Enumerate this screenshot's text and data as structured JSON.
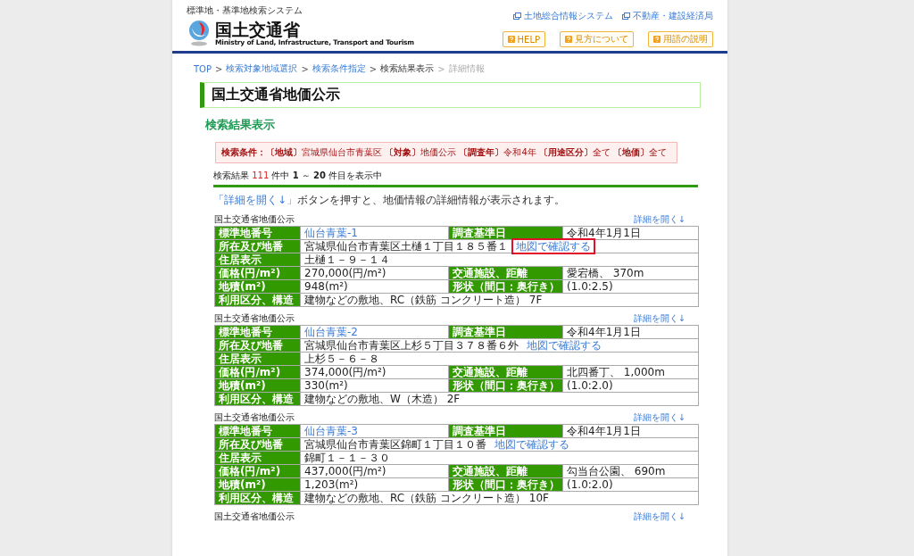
{
  "header": {
    "system_name": "標準地・基準地検索システム",
    "logo_name": "国土交通省",
    "logo_english": "Ministry of Land, Infrastructure, Transport and Tourism",
    "links": [
      "土地総合情報システム",
      "不動産・建設経済局"
    ],
    "help_buttons": [
      "HELP",
      "見方について",
      "用語の説明"
    ]
  },
  "breadcrumb": [
    {
      "label": "TOP",
      "kind": "link",
      "separator": ">"
    },
    {
      "label": "検索対象地域選択",
      "kind": "link",
      "separator": ">"
    },
    {
      "label": "検索条件指定",
      "kind": "link",
      "separator": ">"
    },
    {
      "label": "検索結果表示",
      "kind": "current",
      "separator": ">"
    },
    {
      "label": "詳細情報",
      "kind": "pending"
    }
  ],
  "page_title": "国土交通省地価公示",
  "section_title": "検索結果表示",
  "conditions": {
    "label": "検索条件：",
    "text": "**〔地域〕**宮城県仙台市青葉区 **〔対象〕**地価公示 **〔調査年〕**令和4年 **〔用途区分〕**全て **〔地価〕**全て"
  },
  "result_count": [
    {
      "text": "検索結果 ",
      "kind": "plain"
    },
    {
      "text": "111",
      "kind": "count"
    },
    {
      "text": " 件中 ",
      "kind": "plain"
    },
    {
      "text": "1",
      "kind": "bold"
    },
    {
      "text": " ～ ",
      "kind": "plain"
    },
    {
      "text": "20",
      "kind": "bold"
    },
    {
      "text": " 件目を表示中",
      "kind": "plain"
    }
  ],
  "hint": {
    "link": "「詳細を開く↓」",
    "text": "ボタンを押すと、地価情報の詳細情報が表示されます。"
  },
  "records": [
    {
      "heading": "国土交通省地価公示",
      "open_label": "詳細を開く↓",
      "rows": [
        {
          "label": "標準地番号",
          "value": "仙台青葉-1",
          "value_link": true,
          "label2": "調査基準日",
          "value2": "令和4年1月1日"
        },
        {
          "label": "所在及び地番",
          "value": "宮城県仙台市青葉区土樋１丁目１８５番１",
          "map_link": "地図で確認する",
          "highlighted": true
        },
        {
          "label": "住居表示",
          "value": "土樋１－９－１４"
        },
        {
          "label": "価格(円/m²)",
          "value": "270,000(円/m²)",
          "label2": "交通施設、距離",
          "value2": "愛宕橋、 370m"
        },
        {
          "label": "地積(m²)",
          "value": "948(m²)",
          "label2": "形状（間口：奥行き）",
          "value2": "(1.0:2.5)"
        },
        {
          "label": "利用区分、構造",
          "value": "建物などの敷地、RC（鉄筋 コンクリート造） 7F"
        }
      ]
    },
    {
      "heading": "国土交通省地価公示",
      "open_label": "詳細を開く↓",
      "rows": [
        {
          "label": "標準地番号",
          "value": "仙台青葉-2",
          "value_link": true,
          "label2": "調査基準日",
          "value2": "令和4年1月1日"
        },
        {
          "label": "所在及び地番",
          "value": "宮城県仙台市青葉区上杉５丁目３７８番６外",
          "map_link": "地図で確認する",
          "highlighted": false
        },
        {
          "label": "住居表示",
          "value": "上杉５－６－８"
        },
        {
          "label": "価格(円/m²)",
          "value": "374,000(円/m²)",
          "label2": "交通施設、距離",
          "value2": "北四番丁、 1,000m"
        },
        {
          "label": "地積(m²)",
          "value": "330(m²)",
          "label2": "形状（間口：奥行き）",
          "value2": "(1.0:2.0)"
        },
        {
          "label": "利用区分、構造",
          "value": "建物などの敷地、W（木造） 2F"
        }
      ]
    },
    {
      "heading": "国土交通省地価公示",
      "open_label": "詳細を開く↓",
      "rows": [
        {
          "label": "標準地番号",
          "value": "仙台青葉-3",
          "value_link": true,
          "label2": "調査基準日",
          "value2": "令和4年1月1日"
        },
        {
          "label": "所在及び地番",
          "value": "宮城県仙台市青葉区錦町１丁目１０番",
          "map_link": "地図で確認する",
          "highlighted": false
        },
        {
          "label": "住居表示",
          "value": "錦町１－１－３０"
        },
        {
          "label": "価格(円/m²)",
          "value": "437,000(円/m²)",
          "label2": "交通施設、距離",
          "value2": "勾当台公園、 690m"
        },
        {
          "label": "地積(m²)",
          "value": "1,203(m²)",
          "label2": "形状（間口：奥行き）",
          "value2": "(1.0:2.0)"
        },
        {
          "label": "利用区分、構造",
          "value": "建物などの敷地、RC（鉄筋 コンクリート造） 10F"
        }
      ]
    },
    {
      "heading": "国土交通省地価公示",
      "open_label": "詳細を開く↓"
    }
  ]
}
